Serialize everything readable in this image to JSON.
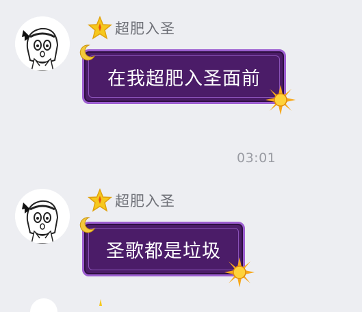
{
  "messages": [
    {
      "sender": "超肥入圣",
      "text": "在我超肥入圣面前"
    },
    {
      "sender": "超肥入圣",
      "text": "圣歌都是垃圾"
    }
  ],
  "timestamp": "03:01",
  "colors": {
    "background": "#edeef2",
    "bubble_fill": "#4b1c68",
    "bubble_border": "#9c5ed0",
    "bubble_text": "#ffffff",
    "name_text": "#6f7178",
    "timestamp_text": "#9a9ca3",
    "star_badge": "#f5c518"
  },
  "icons": {
    "avatar": "anime-girl-avatar",
    "badge": "star-badge-icon",
    "bubble_decor_top": "crescent-moon-icon",
    "bubble_decor_bottom": "sun-icon"
  }
}
